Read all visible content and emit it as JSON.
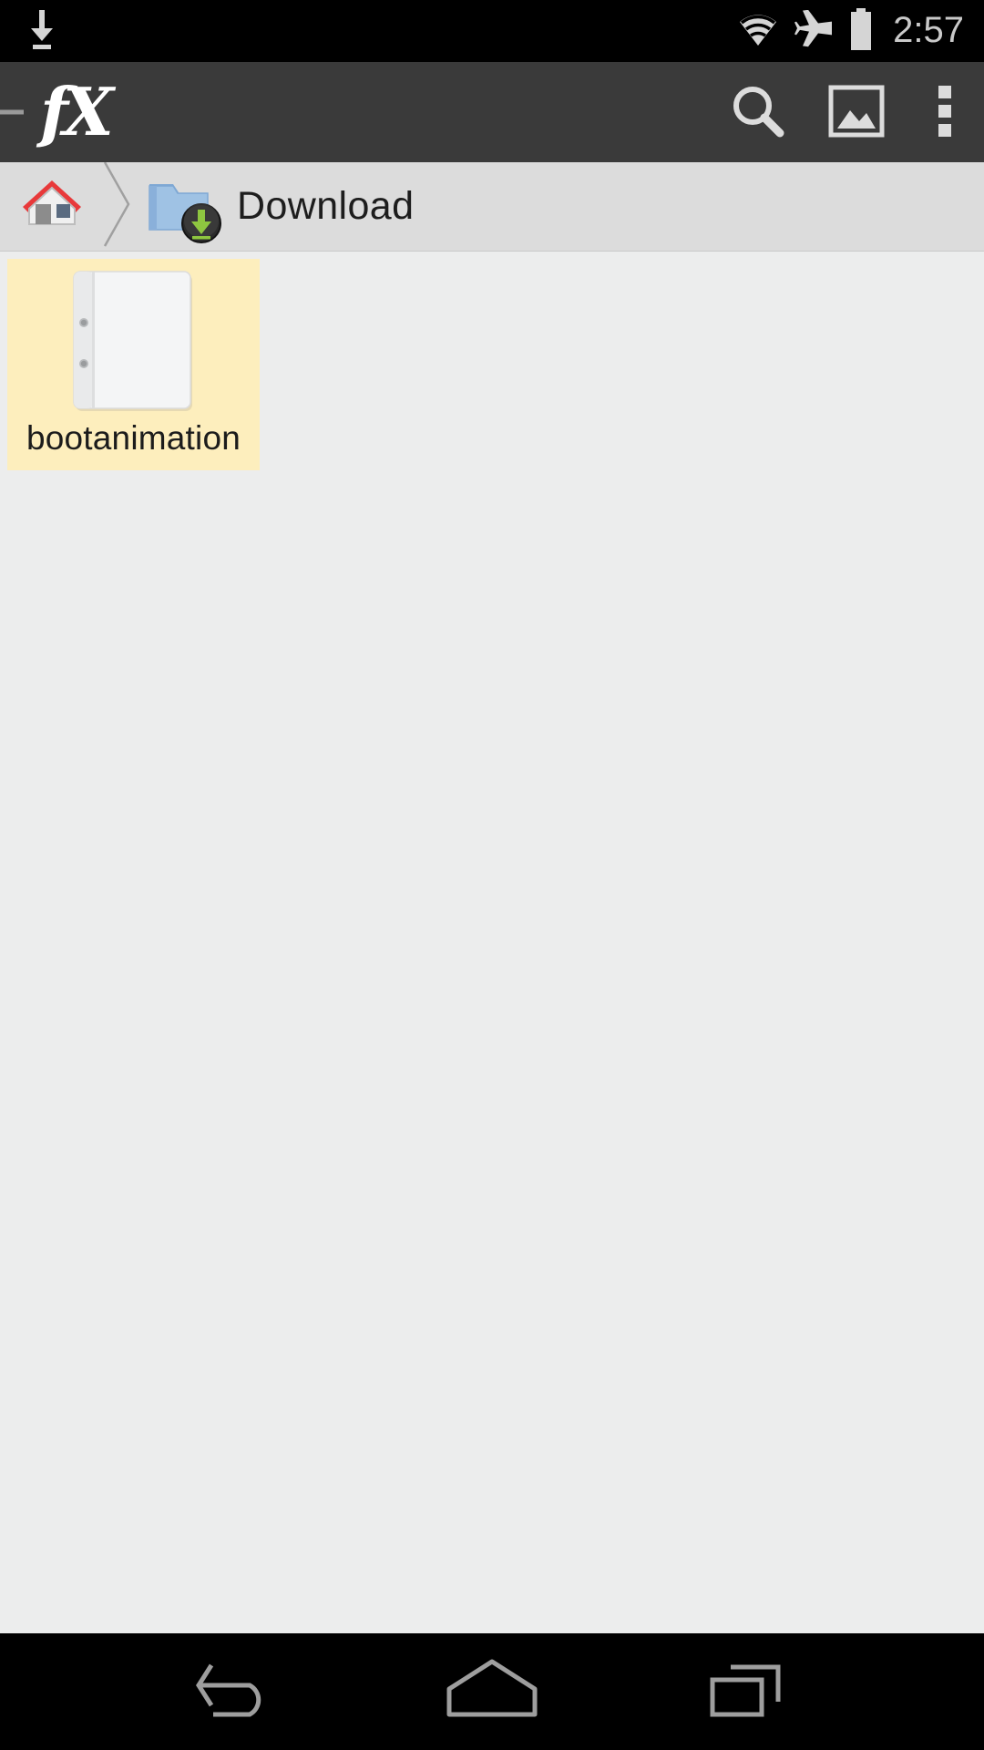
{
  "status_bar": {
    "download_icon": "download-indicator-icon",
    "wifi_icon": "wifi-icon",
    "airplane_icon": "airplane-mode-icon",
    "battery_icon": "battery-icon",
    "time": "2:57"
  },
  "app_bar": {
    "logo_text": "fX",
    "drawer_hint": "drawer-edge-hint",
    "actions": [
      {
        "name": "search-icon",
        "label": "Search"
      },
      {
        "name": "image-icon",
        "label": "Gallery"
      },
      {
        "name": "overflow-menu-icon",
        "label": "More options"
      }
    ]
  },
  "breadcrumb": {
    "home_label": "Home",
    "separator": "chevron-right-icon",
    "current": {
      "label": "Download",
      "icon": "folder-download-icon"
    }
  },
  "files": {
    "items": [
      {
        "name": "bootanimation",
        "icon": "document-file-icon",
        "selected": true
      }
    ]
  },
  "nav_bar": {
    "buttons": [
      {
        "name": "back-button",
        "label": "Back"
      },
      {
        "name": "home-button",
        "label": "Home"
      },
      {
        "name": "recents-button",
        "label": "Recent apps"
      }
    ]
  },
  "colors": {
    "status_bar_bg": "#000000",
    "app_bar_bg": "#3a3a3a",
    "breadcrumb_bg": "#dcdcdc",
    "content_bg": "#eceded",
    "tile_selected_bg": "#fdeebd",
    "nav_bar_bg": "#000000",
    "icon_tint": "#d5d5d5",
    "nav_icon_tint": "#9e9e9e",
    "home_roof_red": "#e8393a",
    "folder_blue": "#9fc2e4",
    "download_green": "#8ec640"
  }
}
